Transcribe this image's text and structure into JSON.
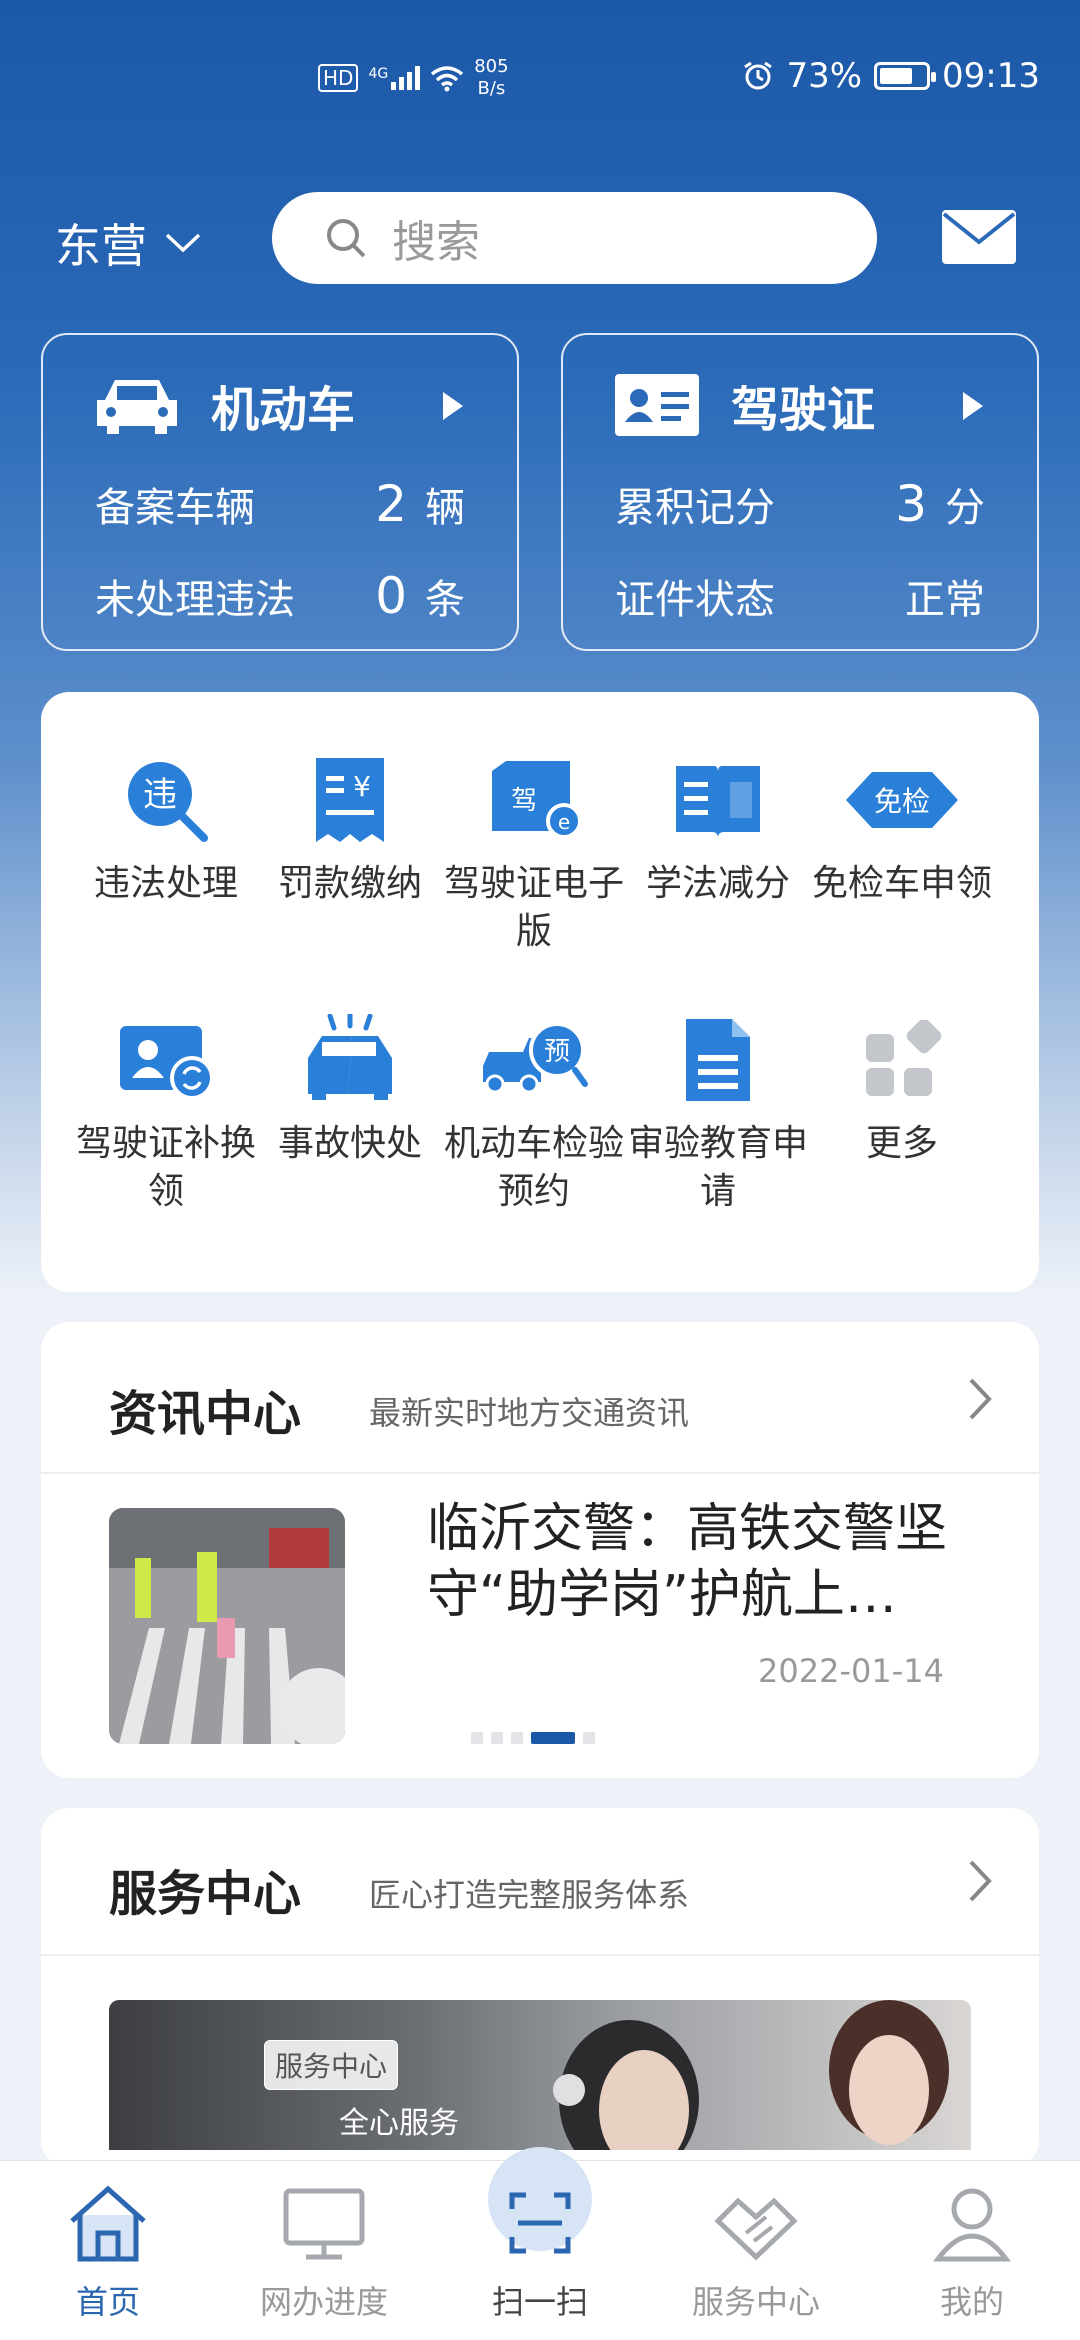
{
  "status_bar": {
    "signal": "4G",
    "hd": "HD",
    "net_speed_value": "805",
    "net_speed_unit": "B/s",
    "battery": "73%",
    "battery_level": 0.73,
    "time": "09:13"
  },
  "header": {
    "city": "东营",
    "search_placeholder": "搜索"
  },
  "vehicle_card": {
    "title": "机动车",
    "rows": [
      {
        "label": "备案车辆",
        "value": "2",
        "unit": "辆"
      },
      {
        "label": "未处理违法",
        "value": "0",
        "unit": "条"
      }
    ]
  },
  "license_card": {
    "title": "驾驶证",
    "rows": [
      {
        "label": "累积记分",
        "value": "3",
        "unit": "分"
      },
      {
        "label": "证件状态",
        "value": "",
        "unit": "正常"
      }
    ]
  },
  "services": [
    {
      "icon": "violation-search-icon",
      "label": "违法处理"
    },
    {
      "icon": "fine-payment-icon",
      "label": "罚款缴纳"
    },
    {
      "icon": "e-license-icon",
      "label": "驾驶证电子版"
    },
    {
      "icon": "study-book-icon",
      "label": "学法减分"
    },
    {
      "icon": "inspection-exempt-icon",
      "label": "免检车申领"
    },
    {
      "icon": "license-renew-icon",
      "label": "驾驶证补换领"
    },
    {
      "icon": "accident-icon",
      "label": "事故快处"
    },
    {
      "icon": "inspection-appointment-icon",
      "label": "机动车检验预约"
    },
    {
      "icon": "document-icon",
      "label": "审验教育申请"
    },
    {
      "icon": "more-grid-icon",
      "label": "更多"
    }
  ],
  "news": {
    "title": "资讯中心",
    "subtitle": "最新实时地方交通资讯",
    "article_title": "临沂交警：高铁交警坚守“助学岗”护航上…",
    "date": "2022-01-14"
  },
  "service_center": {
    "title": "服务中心",
    "subtitle": "匠心打造完整服务体系",
    "banner_tag": "服务中心",
    "banner_text": "全心服务"
  },
  "tabs": [
    {
      "icon": "home-icon",
      "label": "首页"
    },
    {
      "icon": "monitor-icon",
      "label": "网办进度"
    },
    {
      "icon": "scan-icon",
      "label": "扫一扫"
    },
    {
      "icon": "handshake-icon",
      "label": "服务中心"
    },
    {
      "icon": "user-icon",
      "label": "我的"
    }
  ],
  "colors": {
    "brand_blue": "#1c58a8",
    "icon_blue": "#2a7fd8",
    "active_tab": "#2b66b1"
  }
}
